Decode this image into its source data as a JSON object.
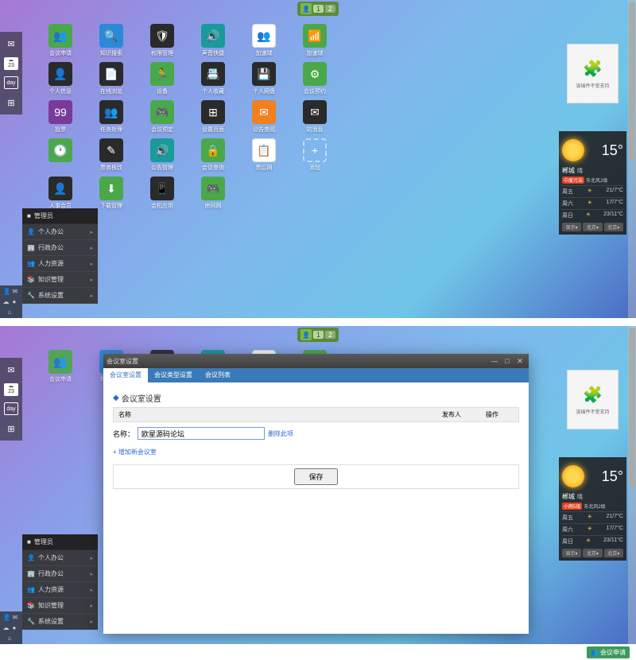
{
  "pager": {
    "page1": "1",
    "page2": "2"
  },
  "dock": {
    "cal_num": "23",
    "day": "day"
  },
  "apps_row1": [
    {
      "label": "会议申请",
      "color": "c-green",
      "glyph": "👥"
    },
    {
      "label": "知识搜索",
      "color": "c-blue",
      "glyph": "🔍"
    },
    {
      "label": "权限管理",
      "color": "c-dark",
      "glyph": "🛡"
    },
    {
      "label": "声音快捷",
      "color": "c-teal",
      "glyph": "🔊"
    },
    {
      "label": "加速球",
      "color": "c-white",
      "glyph": "👥"
    },
    {
      "label": "加速球",
      "color": "c-green",
      "glyph": "📶"
    }
  ],
  "apps_row2": [
    {
      "label": "个人信息",
      "color": "c-dark",
      "glyph": "👤"
    },
    {
      "label": "在线浏览",
      "color": "c-dark",
      "glyph": "📄"
    },
    {
      "label": "设备",
      "color": "c-green",
      "glyph": "🏃"
    },
    {
      "label": "个人收藏",
      "color": "c-dark",
      "glyph": "📇"
    },
    {
      "label": "个人网盘",
      "color": "c-dark",
      "glyph": "💾"
    },
    {
      "label": "会议预约",
      "color": "c-green",
      "glyph": "⚙"
    }
  ],
  "apps_row3": [
    {
      "label": "投票",
      "color": "c-purple",
      "glyph": "99"
    },
    {
      "label": "任务处理",
      "color": "c-dark",
      "glyph": "👥"
    },
    {
      "label": "会议预定",
      "color": "c-green",
      "glyph": "🎮"
    },
    {
      "label": "设置页面",
      "color": "c-dark",
      "glyph": "⊞"
    },
    {
      "label": "公告查阅",
      "color": "c-orange",
      "glyph": "✉"
    },
    {
      "label": "站消息",
      "color": "c-dark",
      "glyph": "✉"
    }
  ],
  "apps_row4": [
    {
      "label": "",
      "color": "c-green",
      "glyph": "🕐"
    },
    {
      "label": "票务核改",
      "color": "c-dark",
      "glyph": "✎"
    },
    {
      "label": "公告管理",
      "color": "c-teal",
      "glyph": "🔊"
    },
    {
      "label": "会议查询",
      "color": "c-green",
      "glyph": "🔒"
    },
    {
      "label": "票后网",
      "color": "c-white",
      "glyph": "📋"
    },
    {
      "label": "添加",
      "color": "c-dashed",
      "glyph": "+"
    }
  ],
  "apps_row5": [
    {
      "label": "人事会员",
      "color": "c-dark",
      "glyph": "👤"
    },
    {
      "label": "下载管理",
      "color": "c-green",
      "glyph": "⬇"
    },
    {
      "label": "会机应用",
      "color": "c-dark",
      "glyph": "📱"
    },
    {
      "label": "房间网",
      "color": "c-green",
      "glyph": "🎮"
    }
  ],
  "menu": {
    "header": "管理员",
    "items": [
      "个人办公",
      "行政办公",
      "人力资源",
      "知识管理",
      "系统设置"
    ]
  },
  "plugin": {
    "text": "该插件不受支持"
  },
  "weather": {
    "city": "郴城",
    "cond": "晴",
    "badge": "中度污染",
    "wind": "东北风2级",
    "temp": "15°",
    "days": [
      {
        "d": "周五",
        "t": "21/7°C"
      },
      {
        "d": "周六",
        "t": "17/7°C"
      },
      {
        "d": "周日",
        "t": "23/11°C"
      }
    ],
    "sel": [
      "显示▾",
      "北京▾",
      "北京▾"
    ]
  },
  "weather2_badge": "小雨5级",
  "weather2_wind": "东北风2级",
  "window": {
    "title": "会议室设置",
    "tabs": [
      "会议室设置",
      "会议类型设置",
      "会议列表"
    ],
    "section": "会议室设置",
    "th": [
      "名称",
      "发布人",
      "操作"
    ],
    "field_label": "名称：",
    "field_value": "欧星源码论坛",
    "del": "删除此项",
    "add": "+ 增加新会议室",
    "save": "保存"
  },
  "footer": {
    "label": "会议申请"
  }
}
